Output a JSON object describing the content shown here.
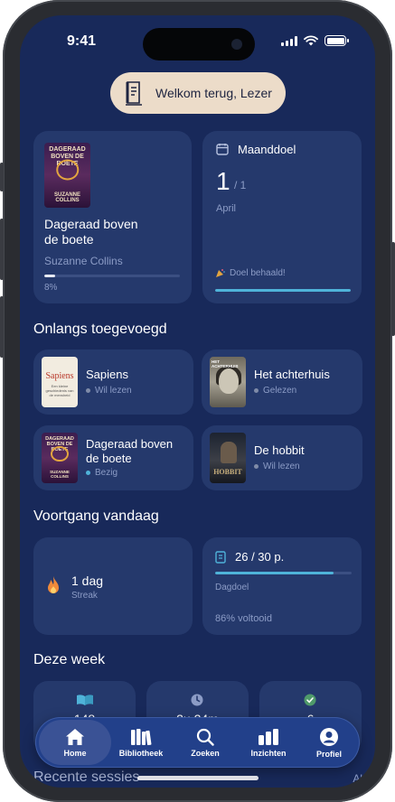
{
  "status_bar": {
    "time": "9:41"
  },
  "welcome": {
    "text": "Welkom terug, Lezer"
  },
  "current_book": {
    "title": "Dageraad boven de boete",
    "author": "Suzanne Collins",
    "progress_percent": 8,
    "progress_label": "8%",
    "cover": {
      "title_text": "DAGERAAD BOVEN DE BOETE",
      "author_text": "SUZANNE COLLINS"
    }
  },
  "monthly_goal": {
    "label": "Maanddoel",
    "count": "1",
    "total": "/ 1",
    "month": "April",
    "achieved_text": "Doel behaald!",
    "progress_fraction": 1.0,
    "icon": "calendar-icon"
  },
  "recent": {
    "heading": "Onlangs toegevoegd",
    "items": [
      {
        "title": "Sapiens",
        "status": "Wil lezen",
        "status_color": "#7f8ba8",
        "cover_title": "Sapiens",
        "cover_sub": "Een kleine geschiedenis van de mensheid",
        "cover_author": "Yuval Noah Harari"
      },
      {
        "title": "Het achterhuis",
        "status": "Gelezen",
        "status_color": "#7f8ba8",
        "cover_title": "HET ACHTERHUIS"
      },
      {
        "title": "Dageraad boven de boete",
        "status": "Bezig",
        "status_color": "#4fb3d9",
        "cover_title": "DAGERAAD BOVEN DE BOETE",
        "cover_author": "SUZANNE COLLINS"
      },
      {
        "title": "De hobbit",
        "status": "Wil lezen",
        "status_color": "#7f8ba8",
        "cover_title": "HOBBIT"
      }
    ]
  },
  "today": {
    "heading": "Voortgang vandaag",
    "streak_value": "1 dag",
    "streak_label": "Streak",
    "pages_value": "26 / 30 p.",
    "pages_label": "Dagdoel",
    "pages_fraction": 0.87,
    "completed_text": "86% voltooid"
  },
  "week": {
    "heading": "Deze week",
    "stats": [
      {
        "icon": "book-open-icon",
        "value": "148"
      },
      {
        "icon": "clock-icon",
        "value": "2u 24m"
      },
      {
        "icon": "check-circle-icon",
        "value": "6"
      }
    ]
  },
  "sessions": {
    "heading": "Recente sessies",
    "link": "Al"
  },
  "tabbar": {
    "items": [
      {
        "label": "Home",
        "icon": "home-icon",
        "active": true
      },
      {
        "label": "Bibliotheek",
        "icon": "books-icon",
        "active": false
      },
      {
        "label": "Zoeken",
        "icon": "search-icon",
        "active": false
      },
      {
        "label": "Inzichten",
        "icon": "bar-chart-icon",
        "active": false
      },
      {
        "label": "Profiel",
        "icon": "profile-icon",
        "active": false
      }
    ]
  },
  "colors": {
    "background": "#18295a",
    "card": "#25396c",
    "accent": "#4fb3d9",
    "welcome_pill": "#ecdcc9",
    "tabbar": "#22408a"
  }
}
